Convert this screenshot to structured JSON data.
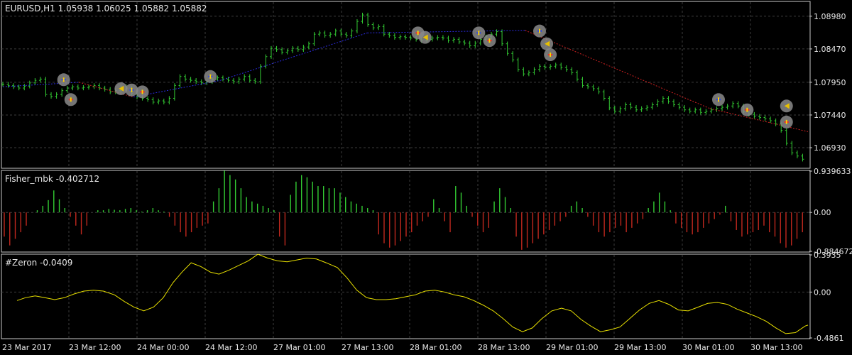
{
  "colors": {
    "background": "#000000",
    "grid": "#3c3c3c",
    "panel_border": "#c8c8c8",
    "candle_bar": "#33cc33",
    "zigzag_up": "#2b2bdd",
    "zigzag_down": "#cc2020",
    "fisher_pos": "#33cc33",
    "fisher_neg": "#c0281e",
    "zeron_line": "#e8e000",
    "marker_ring": "#8a8a8a",
    "text": "#e6e6e6"
  },
  "chart_data": [
    {
      "type": "ohlc-bars",
      "title": "EURUSD,H1  1.05938 1.06025 1.05882 1.05882",
      "ylim": [
        1.0662,
        1.092
      ],
      "ytick_labels": [
        "1.08980",
        "1.08470",
        "1.07950",
        "1.07440",
        "1.06930"
      ],
      "closes": [
        1.0792,
        1.079,
        1.0788,
        1.0786,
        1.0789,
        1.0794,
        1.0798,
        1.08,
        1.0776,
        1.0773,
        1.0776,
        1.0782,
        1.0786,
        1.0788,
        1.0786,
        1.0787,
        1.0788,
        1.079,
        1.0786,
        1.0784,
        1.078,
        1.0782,
        1.0788,
        1.0786,
        1.0778,
        1.0772,
        1.077,
        1.0768,
        1.0764,
        1.0766,
        1.0764,
        1.077,
        1.079,
        1.0804,
        1.08,
        1.0798,
        1.0796,
        1.0794,
        1.0796,
        1.08,
        1.0802,
        1.08,
        1.0798,
        1.0796,
        1.08,
        1.0804,
        1.0798,
        1.0796,
        1.082,
        1.0835,
        1.0848,
        1.0846,
        1.0842,
        1.0844,
        1.0848,
        1.0846,
        1.085,
        1.0855,
        1.087,
        1.0872,
        1.0868,
        1.087,
        1.0875,
        1.087,
        1.0868,
        1.0875,
        1.089,
        1.09,
        1.0885,
        1.088,
        1.0882,
        1.087,
        1.0868,
        1.0865,
        1.0866,
        1.0865,
        1.0864,
        1.0862,
        1.086,
        1.0862,
        1.0864,
        1.0865,
        1.0864,
        1.086,
        1.0862,
        1.0858,
        1.0856,
        1.0852,
        1.0856,
        1.0862,
        1.0866,
        1.087,
        1.0874,
        1.0855,
        1.084,
        1.083,
        1.0815,
        1.0808,
        1.081,
        1.0815,
        1.082,
        1.0818,
        1.082,
        1.0822,
        1.0818,
        1.0815,
        1.081,
        1.08,
        1.079,
        1.0788,
        1.0785,
        1.078,
        1.077,
        1.0755,
        1.075,
        1.0754,
        1.076,
        1.0756,
        1.0752,
        1.0754,
        1.0756,
        1.076,
        1.0765,
        1.077,
        1.0765,
        1.076,
        1.0756,
        1.0752,
        1.075,
        1.0752,
        1.0748,
        1.075,
        1.0752,
        1.0754,
        1.0756,
        1.0758,
        1.0762,
        1.0758,
        1.075,
        1.0745,
        1.0742,
        1.074,
        1.0738,
        1.0735,
        1.073,
        1.072,
        1.07,
        1.0685,
        1.068,
        1.0675
      ],
      "zigzag": [
        {
          "t": 0,
          "price": 1.0788
        },
        {
          "t": 14,
          "price": 1.0795
        },
        {
          "t": 24,
          "price": 1.0772
        },
        {
          "t": 40,
          "price": 1.0798
        },
        {
          "t": 67,
          "price": 1.0872
        },
        {
          "t": 96,
          "price": 1.0876
        },
        {
          "t": 130,
          "price": 1.0754
        },
        {
          "t": 148,
          "price": 1.0718
        }
      ],
      "markers": [
        {
          "t": 17,
          "price": 1.0799,
          "kind": "buy"
        },
        {
          "t": 19,
          "price": 1.0768,
          "kind": "sell"
        },
        {
          "t": 33,
          "price": 1.0785,
          "kind": "wedge"
        },
        {
          "t": 36,
          "price": 1.0783,
          "kind": "buy"
        },
        {
          "t": 39,
          "price": 1.078,
          "kind": "sell"
        },
        {
          "t": 58,
          "price": 1.0804,
          "kind": "buy"
        },
        {
          "t": 116,
          "price": 1.0872,
          "kind": "sell"
        },
        {
          "t": 118,
          "price": 1.0865,
          "kind": "wedge"
        },
        {
          "t": 133,
          "price": 1.0872,
          "kind": "buy"
        },
        {
          "t": 136,
          "price": 1.086,
          "kind": "sell"
        },
        {
          "t": 150,
          "price": 1.0875,
          "kind": "buy"
        },
        {
          "t": 152,
          "price": 1.0855,
          "kind": "wedge"
        },
        {
          "t": 153,
          "price": 1.0838,
          "kind": "sell"
        },
        {
          "t": 200,
          "price": 1.0768,
          "kind": "buy"
        },
        {
          "t": 208,
          "price": 1.0752,
          "kind": "sell"
        },
        {
          "t": 219,
          "price": 1.0758,
          "kind": "wedge"
        },
        {
          "t": 219,
          "price": 1.0733,
          "kind": "sell"
        }
      ]
    },
    {
      "type": "bar",
      "title": "Fisher_mbk -0.402712",
      "ylim": [
        -0.884672,
        0.939633
      ],
      "ytick_labels": [
        "0.939633",
        "0.00",
        "-0.884672"
      ],
      "values": [
        -0.55,
        -0.75,
        -0.6,
        -0.45,
        -0.3,
        0,
        0.05,
        0.15,
        0.28,
        0.5,
        0.3,
        0.1,
        -0.1,
        -0.3,
        -0.5,
        -0.3,
        0,
        0.05,
        0.05,
        0.08,
        0.06,
        0.05,
        0.08,
        0.1,
        0.05,
        0.02,
        0.05,
        0.1,
        0.05,
        0.02,
        -0.1,
        -0.3,
        -0.45,
        -0.55,
        -0.45,
        -0.35,
        -0.3,
        -0.25,
        0.25,
        0.55,
        0.95,
        0.85,
        0.75,
        0.55,
        0.35,
        0.25,
        0.2,
        0.15,
        0.1,
        0.05,
        -0.55,
        -0.75,
        0.4,
        0.7,
        0.85,
        0.8,
        0.7,
        0.6,
        0.6,
        0.55,
        0.55,
        0.45,
        0.35,
        0.25,
        0.2,
        0.15,
        0.1,
        0.05,
        -0.5,
        -0.7,
        -0.8,
        -0.75,
        -0.65,
        -0.55,
        -0.45,
        -0.3,
        -0.2,
        -0.1,
        0.3,
        0.1,
        -0.2,
        -0.45,
        0.6,
        0.45,
        0.15,
        -0.1,
        -0.3,
        -0.45,
        -0.35,
        0.25,
        0.55,
        0.35,
        0.1,
        -0.55,
        -0.85,
        -0.8,
        -0.7,
        -0.6,
        -0.5,
        -0.4,
        -0.3,
        -0.2,
        -0.1,
        0.15,
        0.25,
        0.1,
        -0.1,
        -0.3,
        -0.45,
        -0.55,
        -0.45,
        -0.35,
        -0.3,
        -0.45,
        -0.35,
        -0.25,
        -0.15,
        0.1,
        0.25,
        0.45,
        0.25,
        0.05,
        -0.25,
        -0.35,
        -0.45,
        -0.5,
        -0.45,
        -0.35,
        -0.25,
        -0.15,
        -0.05,
        0.15,
        -0.2,
        -0.4,
        -0.55,
        -0.5,
        -0.45,
        -0.4,
        -0.3,
        -0.45,
        -0.55,
        -0.7,
        -0.8,
        -0.75,
        -0.6,
        -0.45
      ]
    },
    {
      "type": "line",
      "title": "#Zeron -0.0409",
      "ylim": [
        -0.4861,
        0.3935
      ],
      "ytick_labels": [
        "0.3935",
        "0.00",
        "-0.4861"
      ],
      "x": [
        0,
        12,
        26,
        40,
        54,
        68,
        82,
        96,
        110,
        124,
        140,
        154,
        168,
        182,
        196,
        210,
        224,
        238,
        250,
        264,
        278,
        290,
        304,
        318,
        332,
        346,
        360,
        374,
        388,
        402,
        416,
        430,
        444,
        460,
        474,
        488,
        502,
        516,
        530,
        544,
        558,
        572,
        586,
        600,
        614,
        628,
        642,
        656,
        670,
        684,
        698,
        712,
        726,
        740,
        754,
        768,
        782,
        796,
        810,
        824,
        838,
        852,
        866,
        880,
        894,
        908,
        922,
        936,
        950,
        964,
        978,
        992,
        1006,
        1020,
        1034,
        1048,
        1062,
        1076,
        1090,
        1104,
        1118,
        1132,
        1136
      ],
      "values": [
        -0.09,
        -0.06,
        -0.04,
        -0.06,
        -0.08,
        -0.06,
        -0.02,
        0.01,
        0.02,
        0.01,
        -0.03,
        -0.1,
        -0.16,
        -0.2,
        -0.16,
        -0.06,
        0.1,
        0.22,
        0.31,
        0.27,
        0.21,
        0.19,
        0.23,
        0.28,
        0.33,
        0.4,
        0.36,
        0.33,
        0.32,
        0.34,
        0.36,
        0.35,
        0.31,
        0.26,
        0.15,
        0.02,
        -0.06,
        -0.08,
        -0.08,
        -0.07,
        -0.05,
        -0.03,
        0.01,
        0.02,
        0.0,
        -0.03,
        -0.05,
        -0.09,
        -0.14,
        -0.2,
        -0.28,
        -0.37,
        -0.42,
        -0.38,
        -0.28,
        -0.2,
        -0.17,
        -0.2,
        -0.29,
        -0.36,
        -0.42,
        -0.4,
        -0.37,
        -0.28,
        -0.19,
        -0.12,
        -0.09,
        -0.13,
        -0.19,
        -0.2,
        -0.16,
        -0.12,
        -0.11,
        -0.13,
        -0.18,
        -0.22,
        -0.26,
        -0.31,
        -0.38,
        -0.44,
        -0.43,
        -0.36,
        -0.35
      ]
    }
  ],
  "time_axis": {
    "labels": [
      "23 Mar 2017",
      "23 Mar 12:00",
      "24 Mar 00:00",
      "24 Mar 12:00",
      "27 Mar 01:00",
      "27 Mar 13:00",
      "28 Mar 01:00",
      "28 Mar 13:00",
      "29 Mar 01:00",
      "29 Mar 13:00",
      "30 Mar 01:00",
      "30 Mar 13:00"
    ]
  }
}
